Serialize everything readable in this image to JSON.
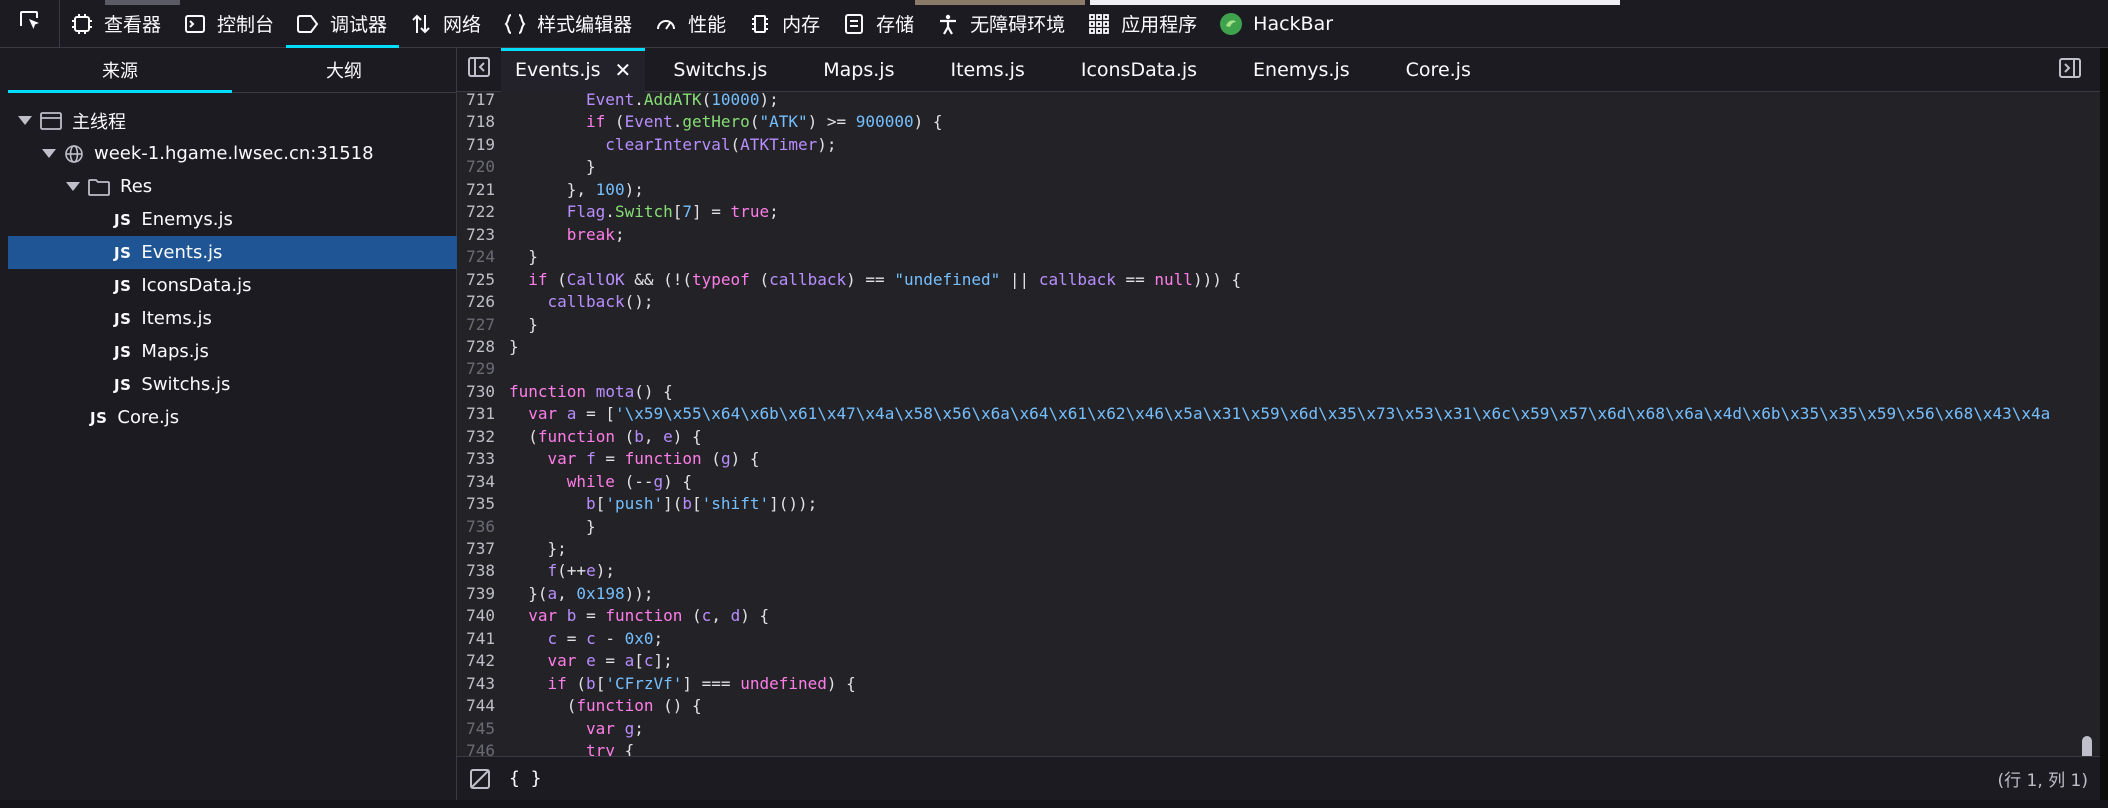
{
  "toolbar": {
    "tools": [
      {
        "label": "查看器",
        "icon": "inspector-icon"
      },
      {
        "label": "控制台",
        "icon": "console-icon"
      },
      {
        "label": "调试器",
        "icon": "debugger-icon",
        "active": true
      },
      {
        "label": "网络",
        "icon": "network-icon"
      },
      {
        "label": "样式编辑器",
        "icon": "style-editor-icon"
      },
      {
        "label": "性能",
        "icon": "performance-icon"
      },
      {
        "label": "内存",
        "icon": "memory-icon"
      },
      {
        "label": "存储",
        "icon": "storage-icon"
      },
      {
        "label": "无障碍环境",
        "icon": "accessibility-icon"
      },
      {
        "label": "应用程序",
        "icon": "application-icon"
      },
      {
        "label": "HackBar",
        "icon": "hackbar-icon"
      }
    ]
  },
  "sources": {
    "tabs": [
      "来源",
      "大纲"
    ],
    "tree": {
      "thread": "主线程",
      "domain": "week-1.hgame.lwsec.cn:31518",
      "folder": "Res",
      "badge": "JS",
      "files": [
        "Enemys.js",
        "Events.js",
        "IconsData.js",
        "Items.js",
        "Maps.js",
        "Switchs.js"
      ],
      "selected": "Events.js",
      "root_file": "Core.js"
    }
  },
  "editor": {
    "tabs": [
      "Events.js",
      "Switchs.js",
      "Maps.js",
      "Items.js",
      "IconsData.js",
      "Enemys.js",
      "Core.js"
    ],
    "active_tab": "Events.js",
    "close_glyph": "✕",
    "status": {
      "pretty_print": "{ }",
      "cursor": "(行 1, 列 1)"
    },
    "lines": [
      {
        "n": "717",
        "dim": false,
        "ind": 8,
        "t": [
          [
            "Event",
            "id"
          ],
          [
            ".",
            "pl"
          ],
          [
            "AddATK",
            "prop"
          ],
          [
            "(",
            "pl"
          ],
          [
            "10000",
            "num"
          ],
          [
            ");",
            "pl"
          ]
        ]
      },
      {
        "n": "718",
        "dim": false,
        "ind": 8,
        "t": [
          [
            "if",
            "kw"
          ],
          [
            " (",
            "pl"
          ],
          [
            "Event",
            "id"
          ],
          [
            ".",
            "pl"
          ],
          [
            "getHero",
            "prop"
          ],
          [
            "(",
            "pl"
          ],
          [
            "\"ATK\"",
            "str"
          ],
          [
            ") >= ",
            "pl"
          ],
          [
            "900000",
            "num"
          ],
          [
            ") {",
            "pl"
          ]
        ]
      },
      {
        "n": "719",
        "dim": false,
        "ind": 10,
        "t": [
          [
            "clearInterval",
            "id"
          ],
          [
            "(",
            "pl"
          ],
          [
            "ATKTimer",
            "id"
          ],
          [
            ");",
            "pl"
          ]
        ]
      },
      {
        "n": "720",
        "dim": true,
        "ind": 8,
        "t": [
          [
            "}",
            "pl"
          ]
        ]
      },
      {
        "n": "721",
        "dim": false,
        "ind": 6,
        "t": [
          [
            "}, ",
            "pl"
          ],
          [
            "100",
            "num"
          ],
          [
            ");",
            "pl"
          ]
        ]
      },
      {
        "n": "722",
        "dim": false,
        "ind": 6,
        "t": [
          [
            "Flag",
            "id"
          ],
          [
            ".",
            "pl"
          ],
          [
            "Switch",
            "prop"
          ],
          [
            "[",
            "pl"
          ],
          [
            "7",
            "num"
          ],
          [
            "] = ",
            "pl"
          ],
          [
            "true",
            "kw"
          ],
          [
            ";",
            "pl"
          ]
        ]
      },
      {
        "n": "723",
        "dim": false,
        "ind": 6,
        "t": [
          [
            "break",
            "kw"
          ],
          [
            ";",
            "pl"
          ]
        ]
      },
      {
        "n": "724",
        "dim": true,
        "ind": 2,
        "t": [
          [
            "}",
            "pl"
          ]
        ]
      },
      {
        "n": "725",
        "dim": false,
        "ind": 2,
        "t": [
          [
            "if",
            "kw"
          ],
          [
            " (",
            "pl"
          ],
          [
            "CallOK",
            "id"
          ],
          [
            " && (!(",
            "pl"
          ],
          [
            "typeof",
            "kw"
          ],
          [
            " (",
            "pl"
          ],
          [
            "callback",
            "id"
          ],
          [
            ") == ",
            "pl"
          ],
          [
            "\"undefined\"",
            "str"
          ],
          [
            " || ",
            "pl"
          ],
          [
            "callback",
            "id"
          ],
          [
            " == ",
            "pl"
          ],
          [
            "null",
            "kw"
          ],
          [
            "))) {",
            "pl"
          ]
        ]
      },
      {
        "n": "726",
        "dim": false,
        "ind": 4,
        "t": [
          [
            "callback",
            "id"
          ],
          [
            "();",
            "pl"
          ]
        ]
      },
      {
        "n": "727",
        "dim": true,
        "ind": 2,
        "t": [
          [
            "}",
            "pl"
          ]
        ]
      },
      {
        "n": "728",
        "dim": false,
        "ind": 0,
        "t": [
          [
            "}",
            "pl"
          ]
        ]
      },
      {
        "n": "729",
        "dim": true,
        "ind": 0,
        "t": []
      },
      {
        "n": "730",
        "dim": false,
        "ind": 0,
        "t": [
          [
            "function",
            "kw"
          ],
          [
            " ",
            "pl"
          ],
          [
            "mota",
            "id"
          ],
          [
            "() {",
            "pl"
          ]
        ]
      },
      {
        "n": "731",
        "dim": false,
        "ind": 2,
        "t": [
          [
            "var",
            "kw"
          ],
          [
            " ",
            "pl"
          ],
          [
            "a",
            "id"
          ],
          [
            " = [",
            "pl"
          ],
          [
            "'\\x59\\x55\\x64\\x6b\\x61\\x47\\x4a\\x58\\x56\\x6a\\x64\\x61\\x62\\x46\\x5a\\x31\\x59\\x6d\\x35\\x73\\x53\\x31\\x6c\\x59\\x57\\x6d\\x68\\x6a\\x4d\\x6b\\x35\\x35\\x59\\x56\\x68\\x43\\x4a",
            "str"
          ]
        ]
      },
      {
        "n": "732",
        "dim": false,
        "ind": 2,
        "t": [
          [
            "(",
            "pl"
          ],
          [
            "function",
            "kw"
          ],
          [
            " (",
            "pl"
          ],
          [
            "b",
            "id"
          ],
          [
            ", ",
            "pl"
          ],
          [
            "e",
            "id"
          ],
          [
            ") {",
            "pl"
          ]
        ]
      },
      {
        "n": "733",
        "dim": false,
        "ind": 4,
        "t": [
          [
            "var",
            "kw"
          ],
          [
            " ",
            "pl"
          ],
          [
            "f",
            "id"
          ],
          [
            " = ",
            "pl"
          ],
          [
            "function",
            "kw"
          ],
          [
            " (",
            "pl"
          ],
          [
            "g",
            "id"
          ],
          [
            ") {",
            "pl"
          ]
        ]
      },
      {
        "n": "734",
        "dim": false,
        "ind": 6,
        "t": [
          [
            "while",
            "kw"
          ],
          [
            " (--",
            "pl"
          ],
          [
            "g",
            "id"
          ],
          [
            ") {",
            "pl"
          ]
        ]
      },
      {
        "n": "735",
        "dim": false,
        "ind": 8,
        "t": [
          [
            "b",
            "id"
          ],
          [
            "[",
            "pl"
          ],
          [
            "'push'",
            "str"
          ],
          [
            "](",
            "pl"
          ],
          [
            "b",
            "id"
          ],
          [
            "[",
            "pl"
          ],
          [
            "'shift'",
            "str"
          ],
          [
            "]());",
            "pl"
          ]
        ]
      },
      {
        "n": "736",
        "dim": true,
        "ind": 8,
        "t": [
          [
            "}",
            "pl"
          ]
        ]
      },
      {
        "n": "737",
        "dim": false,
        "ind": 4,
        "t": [
          [
            "};",
            "pl"
          ]
        ]
      },
      {
        "n": "738",
        "dim": false,
        "ind": 4,
        "t": [
          [
            "f",
            "id"
          ],
          [
            "(++",
            "pl"
          ],
          [
            "e",
            "id"
          ],
          [
            ");",
            "pl"
          ]
        ]
      },
      {
        "n": "739",
        "dim": false,
        "ind": 2,
        "t": [
          [
            "}(",
            "pl"
          ],
          [
            "a",
            "id"
          ],
          [
            ", ",
            "pl"
          ],
          [
            "0x198",
            "num"
          ],
          [
            "));",
            "pl"
          ]
        ]
      },
      {
        "n": "740",
        "dim": false,
        "ind": 2,
        "t": [
          [
            "var",
            "kw"
          ],
          [
            " ",
            "pl"
          ],
          [
            "b",
            "id"
          ],
          [
            " = ",
            "pl"
          ],
          [
            "function",
            "kw"
          ],
          [
            " (",
            "pl"
          ],
          [
            "c",
            "id"
          ],
          [
            ", ",
            "pl"
          ],
          [
            "d",
            "id"
          ],
          [
            ") {",
            "pl"
          ]
        ]
      },
      {
        "n": "741",
        "dim": false,
        "ind": 4,
        "t": [
          [
            "c",
            "id"
          ],
          [
            " = ",
            "pl"
          ],
          [
            "c",
            "id"
          ],
          [
            " - ",
            "pl"
          ],
          [
            "0x0",
            "num"
          ],
          [
            ";",
            "pl"
          ]
        ]
      },
      {
        "n": "742",
        "dim": false,
        "ind": 4,
        "t": [
          [
            "var",
            "kw"
          ],
          [
            " ",
            "pl"
          ],
          [
            "e",
            "id"
          ],
          [
            " = ",
            "pl"
          ],
          [
            "a",
            "id"
          ],
          [
            "[",
            "pl"
          ],
          [
            "c",
            "id"
          ],
          [
            "];",
            "pl"
          ]
        ]
      },
      {
        "n": "743",
        "dim": false,
        "ind": 4,
        "t": [
          [
            "if",
            "kw"
          ],
          [
            " (",
            "pl"
          ],
          [
            "b",
            "id"
          ],
          [
            "[",
            "pl"
          ],
          [
            "'CFrzVf'",
            "str"
          ],
          [
            "] === ",
            "pl"
          ],
          [
            "undefined",
            "kw"
          ],
          [
            ") {",
            "pl"
          ]
        ]
      },
      {
        "n": "744",
        "dim": false,
        "ind": 6,
        "t": [
          [
            "(",
            "pl"
          ],
          [
            "function",
            "kw"
          ],
          [
            " () {",
            "pl"
          ]
        ]
      },
      {
        "n": "745",
        "dim": true,
        "ind": 8,
        "t": [
          [
            "var",
            "kw"
          ],
          [
            " ",
            "pl"
          ],
          [
            "g",
            "id"
          ],
          [
            ";",
            "pl"
          ]
        ]
      },
      {
        "n": "746",
        "dim": true,
        "ind": 8,
        "t": [
          [
            "try",
            "kw"
          ],
          [
            " {",
            "pl"
          ]
        ]
      }
    ]
  }
}
